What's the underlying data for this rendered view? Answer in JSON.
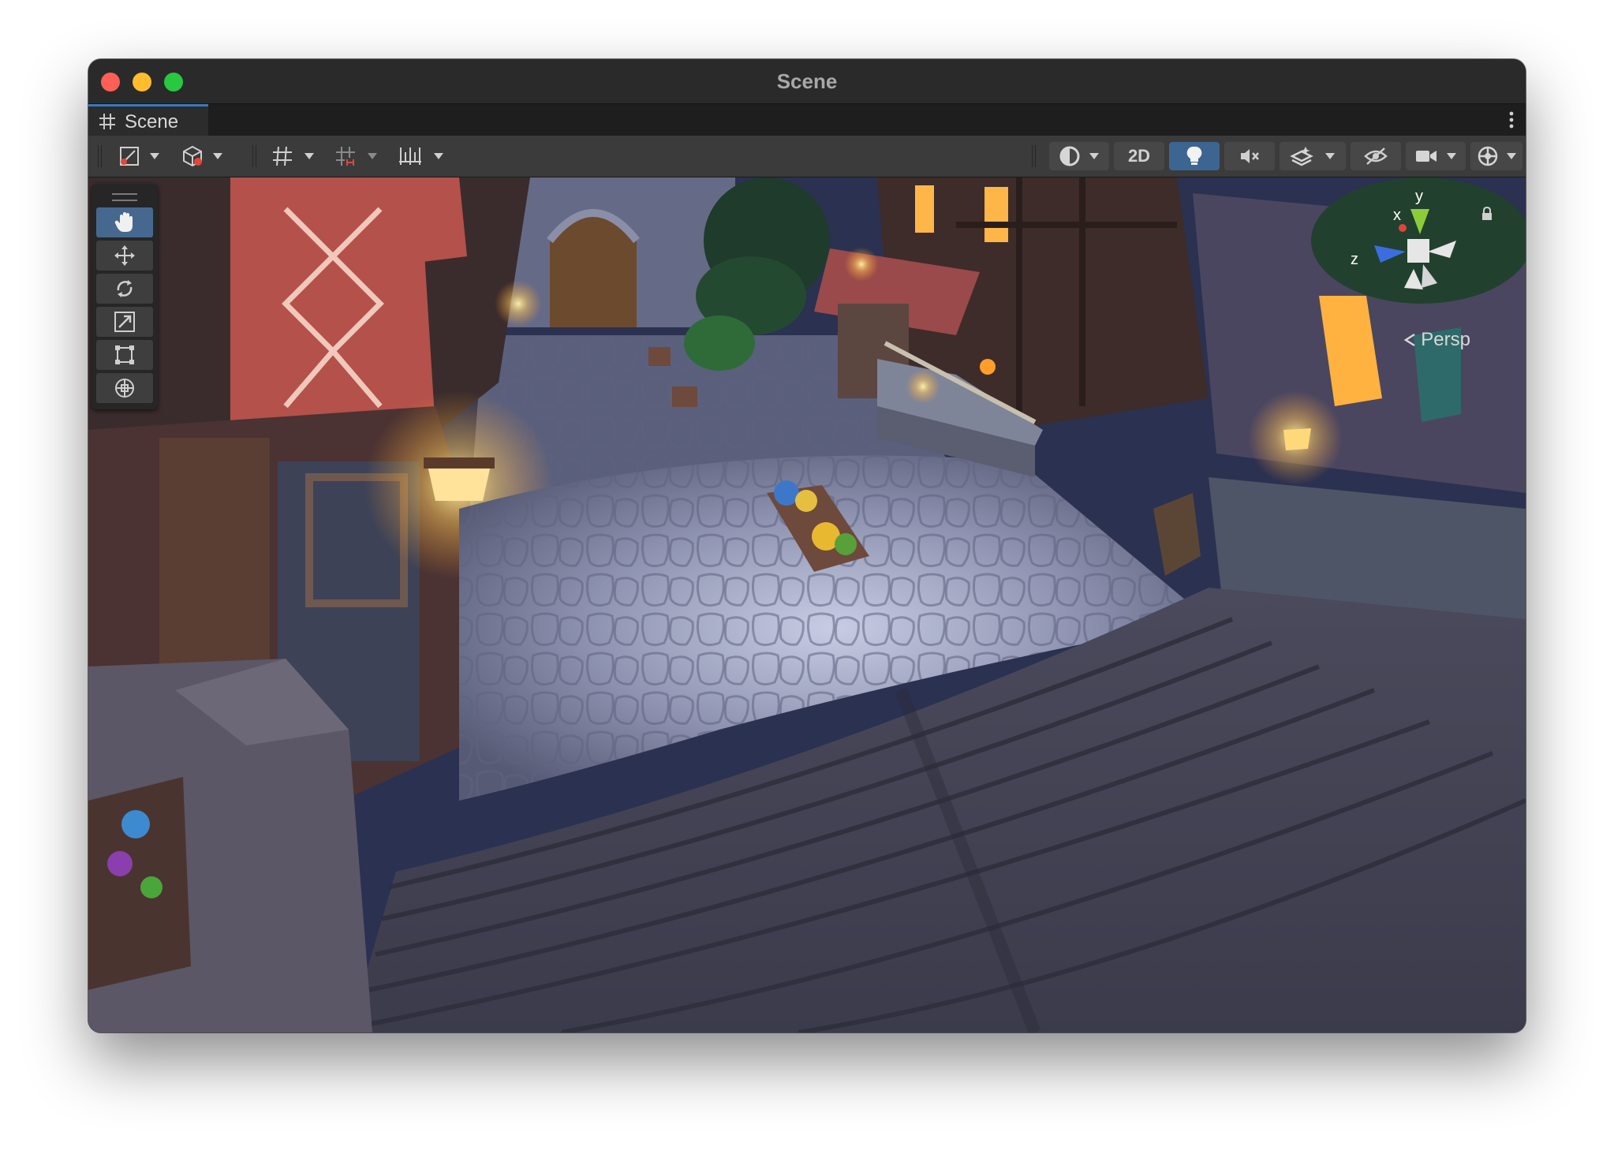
{
  "window": {
    "title": "Scene"
  },
  "tab": {
    "label": "Scene",
    "icon": "grid-hash-icon",
    "menu_icon": "kebab-menu-icon"
  },
  "toolbar": {
    "left": [
      {
        "name": "tool-handle-position-button",
        "icon": "pivot-transform-icon",
        "dropdown": true
      },
      {
        "name": "tool-handle-rotation-button",
        "icon": "global-cube-icon",
        "dropdown": true
      },
      {
        "name": "grid-visibility-button",
        "icon": "grid-icon",
        "dropdown": true
      },
      {
        "name": "grid-snapping-button",
        "icon": "grid-snap-icon",
        "dropdown": true
      },
      {
        "name": "increment-snapping-button",
        "icon": "ruler-icon",
        "dropdown": true
      }
    ],
    "right": [
      {
        "name": "draw-mode-button",
        "icon": "shaded-sphere-icon",
        "dropdown": true
      },
      {
        "name": "2d-toggle-button",
        "label": "2D"
      },
      {
        "name": "lighting-toggle-button",
        "icon": "light-bulb-icon",
        "active": true
      },
      {
        "name": "audio-toggle-button",
        "icon": "muted-speaker-icon"
      },
      {
        "name": "effects-button",
        "icon": "layers-effects-icon",
        "dropdown": true
      },
      {
        "name": "scene-visibility-button",
        "icon": "hidden-eye-icon"
      },
      {
        "name": "camera-settings-button",
        "icon": "video-camera-icon",
        "dropdown": true
      },
      {
        "name": "gizmos-button",
        "icon": "gizmo-globe-icon",
        "dropdown": true
      }
    ]
  },
  "tools": [
    {
      "name": "hand-tool-button",
      "icon": "hand-icon",
      "active": true
    },
    {
      "name": "move-tool-button",
      "icon": "move-arrows-icon"
    },
    {
      "name": "rotate-tool-button",
      "icon": "rotate-icon"
    },
    {
      "name": "scale-tool-button",
      "icon": "scale-icon"
    },
    {
      "name": "rect-tool-button",
      "icon": "rect-transform-icon"
    },
    {
      "name": "transform-tool-button",
      "icon": "transform-icon"
    }
  ],
  "gizmo": {
    "x_label": "x",
    "y_label": "y",
    "z_label": "z",
    "projection": "Persp"
  },
  "colors": {
    "accent": "#3c6591",
    "axis_x": "#e0453a",
    "axis_y": "#8ccc3a",
    "axis_z": "#3a6ee0"
  }
}
